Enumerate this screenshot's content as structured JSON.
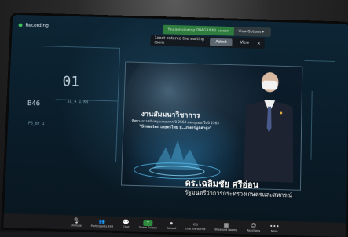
{
  "recording": {
    "label": "Recording"
  },
  "banner": {
    "viewing_text": "You are viewing ONAGRIEB1 screen",
    "view_options": "View Options ▾"
  },
  "waiting_room": {
    "message": "1seat entered the waiting room",
    "admit_label": "Admit",
    "view_label": "View",
    "close_glyph": "×"
  },
  "hud": {
    "big_number": "01",
    "left_code": "B46",
    "small_code_1": "SL_4_1_KR",
    "small_code_2": "F6_8Y_1"
  },
  "slide": {
    "title": "งานสัมมนาวิชาการ",
    "subtitle_line1": "ทิศทางการสนับสนุนเกษตรกร ปี 2564 และมุมมองในปี 2565",
    "subtitle_line2": "\"Smarter เกษตรไทย สู่..เกษตรมูลค่าสูง\""
  },
  "speaker": {
    "name": "ดร.เฉลิมชัย ศรีอ่อน",
    "position": "รัฐมนตรีว่าการกระทรวงเกษตรและสหกรณ์"
  },
  "toolbar": {
    "items": [
      {
        "label": "Unmute",
        "icon": "mic-icon"
      },
      {
        "label": "Participants 343",
        "icon": "participants-icon"
      },
      {
        "label": "Chat",
        "icon": "chat-icon"
      },
      {
        "label": "Share Screen",
        "icon": "share-screen-icon"
      },
      {
        "label": "Record",
        "icon": "record-icon"
      },
      {
        "label": "Live Transcript",
        "icon": "cc-icon"
      },
      {
        "label": "Breakout Rooms",
        "icon": "breakout-icon"
      },
      {
        "label": "Reactions",
        "icon": "reactions-icon"
      },
      {
        "label": "More",
        "icon": "more-icon"
      }
    ],
    "participants_count": "343"
  },
  "colors": {
    "recording_dot": "#3fbf5a",
    "share_green": "#2e8a3c",
    "toolbar_bg": "#1b1b1d"
  }
}
